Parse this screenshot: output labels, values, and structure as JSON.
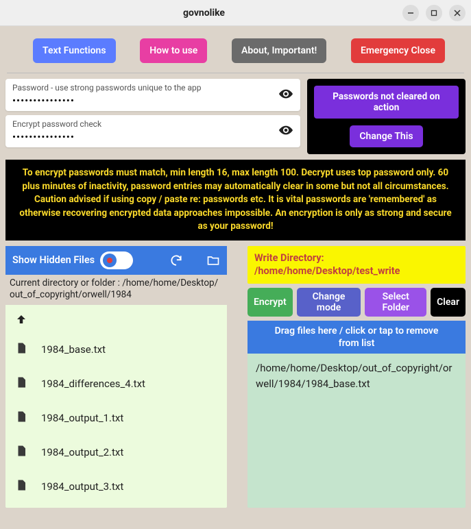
{
  "window": {
    "title": "govnolike"
  },
  "toolbar": {
    "text_functions": "Text Functions",
    "how_to_use": "How to use",
    "about": "About, Important!",
    "emergency": "Emergency Close"
  },
  "password": {
    "field1_label": "Password - use strong passwords unique to the app",
    "field1_value": "•••••••••••••••",
    "field2_label": "Encrypt password check",
    "field2_value": "•••••••••••••••",
    "notice": "Passwords not cleared on action",
    "change_btn": "Change This"
  },
  "warning": "To encrypt passwords must match, min length 16, max length 100.  Decrypt uses top password only.  60 plus minutes of inactivity, password entries may automatically clear in some but not all circumstances.  Caution advised if using copy / paste re: passwords etc. It is vital passwords are 'remembered' as otherwise recovering encrypted data approaches impossible.  An encryption is only as strong and secure as your password!",
  "filepane": {
    "show_hidden": "Show Hidden Files",
    "current_dir_label": "Current directory or folder : /home/home/Desktop/out_of_copyright/orwell/1984",
    "files": [
      "1984_base.txt",
      "1984_differences_4.txt",
      "1984_output_1.txt",
      "1984_output_2.txt",
      "1984_output_3.txt"
    ]
  },
  "rightpane": {
    "write_dir": "Write Directory: /home/home/Desktop/test_write",
    "btn_encrypt": "Encrypt",
    "btn_change_mode": "Change mode",
    "btn_select_folder": "Select Folder",
    "btn_clear": "Clear",
    "drop_header": "Drag files here / click or tap to remove from list",
    "items": [
      "/home/home/Desktop/out_of_copyright/orwell/1984/1984_base.txt"
    ]
  }
}
